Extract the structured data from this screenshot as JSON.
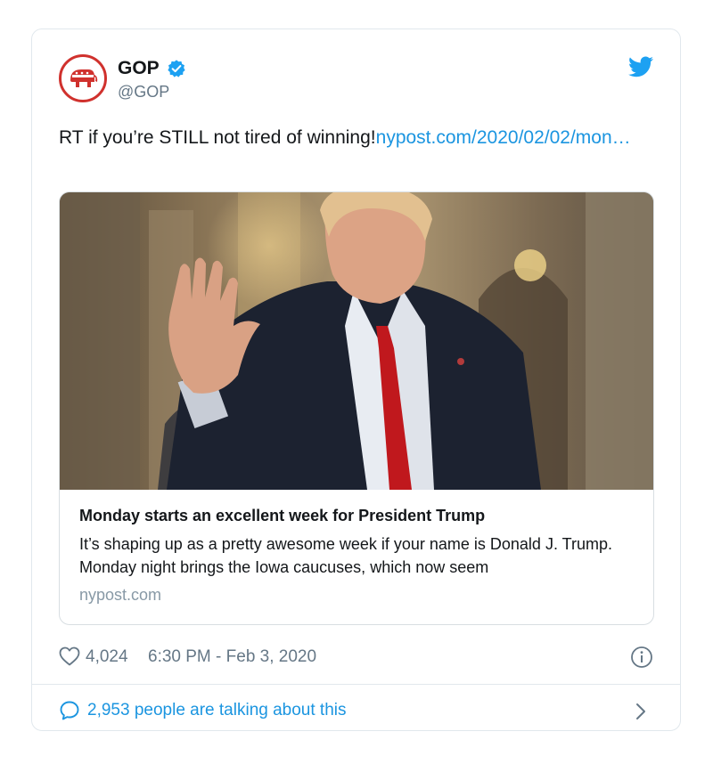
{
  "account": {
    "display_name": "GOP",
    "handle": "@GOP",
    "verified": true,
    "avatar_icon": "republican-elephant-logo",
    "brand_color": "#d0312d"
  },
  "tweet": {
    "text": "RT if you’re STILL not tired of winning!",
    "link": "nypost.com/2020/02/02/mon…"
  },
  "link_card": {
    "image": "man in dark suit and red tie waving, evening building background",
    "title": "Monday starts an excellent week for President Trump",
    "description": "It’s shaping up as a pretty awesome week if your name is Donald J. Trump. Monday night brings the Iowa caucuses, which now seem",
    "domain": "nypost.com"
  },
  "meta": {
    "likes": "4,024",
    "timestamp": "6:30 PM - Feb 3, 2020"
  },
  "footer": {
    "talking": "2,953 people are talking about this"
  },
  "colors": {
    "link": "#1b95e0",
    "secondary_text": "#657786",
    "border": "#e1e8ed"
  }
}
